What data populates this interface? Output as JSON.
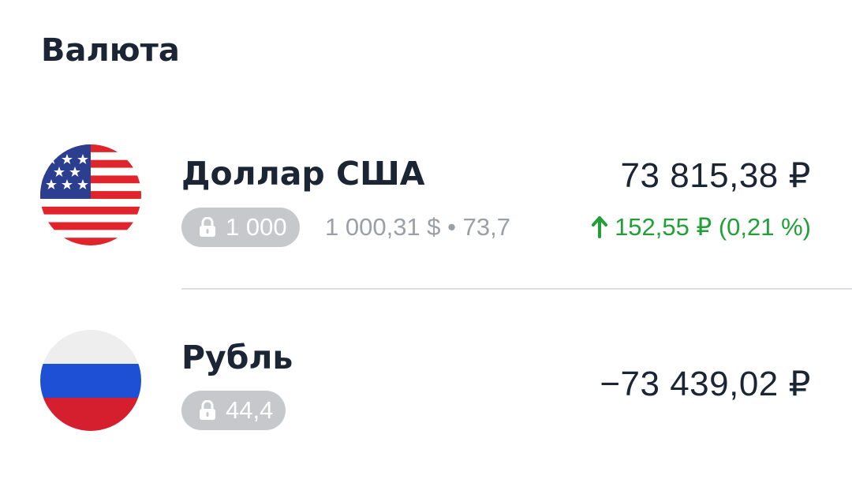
{
  "section": {
    "title": "Валюта"
  },
  "currencies": [
    {
      "name": "Доллар США",
      "flag_icon": "us-flag-icon",
      "amount": "73 815,38 ₽",
      "locked": "1 000",
      "sub_info": "1 000,31 $ • 73,7",
      "change": "152,55 ₽ (0,21 %)",
      "change_direction": "up",
      "change_color": "#21a038"
    },
    {
      "name": "Рубль",
      "flag_icon": "ru-flag-icon",
      "amount": "−73 439,02 ₽",
      "locked": "44,4"
    }
  ],
  "colors": {
    "text_primary": "#1b2533",
    "text_secondary": "#9aa0a6",
    "chip_bg": "#c6c8cb",
    "positive": "#21a038",
    "divider": "#dcdde0"
  }
}
